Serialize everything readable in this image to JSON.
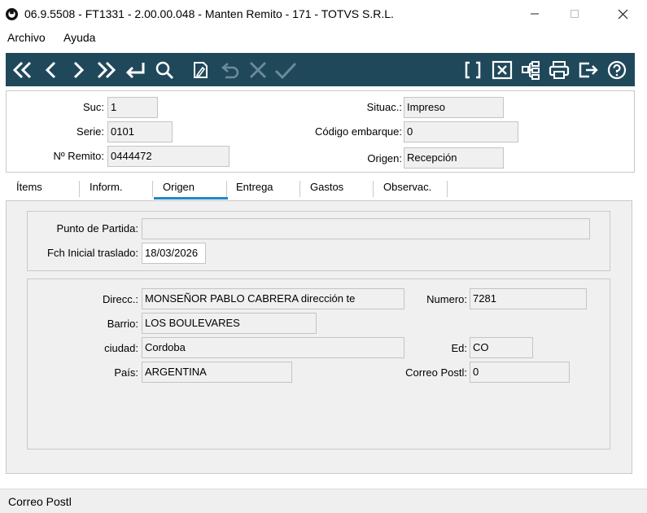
{
  "window": {
    "title": "06.9.5508 - FT1331 - 2.00.00.048 - Manten Remito - 171 - TOTVS S.R.L.",
    "minimize_icon": "minimize-icon",
    "maximize_icon": "maximize-icon",
    "close_icon": "close-icon"
  },
  "menu": {
    "items": [
      "Archivo",
      "Ayuda"
    ]
  },
  "toolbar": {
    "color": "#20485b",
    "icons": [
      "first-record-icon",
      "previous-record-icon",
      "next-record-icon",
      "last-record-icon",
      "return-icon",
      "search-icon",
      "edit-icon",
      "undo-icon",
      "cancel-icon",
      "confirm-icon",
      "brackets-icon",
      "close-box-icon",
      "tree-icon",
      "print-icon",
      "exit-icon",
      "help-icon"
    ]
  },
  "header": {
    "suc_label": "Suc:",
    "suc_value": "1",
    "serie_label": "Serie:",
    "serie_value": "0101",
    "remito_label": "Nº Remito:",
    "remito_value": "0444472",
    "situac_label": "Situac.:",
    "situac_value": "Impreso",
    "codigo_label": "Código embarque:",
    "codigo_value": "0",
    "origen_label": "Origen:",
    "origen_value": "Recepción"
  },
  "tabs": {
    "active": "Origen",
    "accent": "#1e88c8",
    "items": [
      "Ítems",
      "Inform.",
      "Origen",
      "Entrega",
      "Gastos",
      "Observac."
    ]
  },
  "origen": {
    "punto_label": "Punto de Partida:",
    "punto_value": "",
    "fecha_label": "Fch Inicial traslado:",
    "fecha_value": "18/03/2026",
    "direcc_label": "Direcc.:",
    "direcc_value": "MONSEÑOR PABLO CABRERA  dirección te",
    "numero_label": "Numero:",
    "numero_value": "7281",
    "barrio_label": "Barrio:",
    "barrio_value": "LOS BOULEVARES",
    "ciudad_label": "ciudad:",
    "ciudad_value": "Cordoba",
    "ed_label": "Ed:",
    "ed_value": "CO",
    "pais_label": "País:",
    "pais_value": "ARGENTINA",
    "correo_label": "Correo Postl:",
    "correo_value": "0"
  },
  "status": {
    "text": "Correo Postl"
  }
}
